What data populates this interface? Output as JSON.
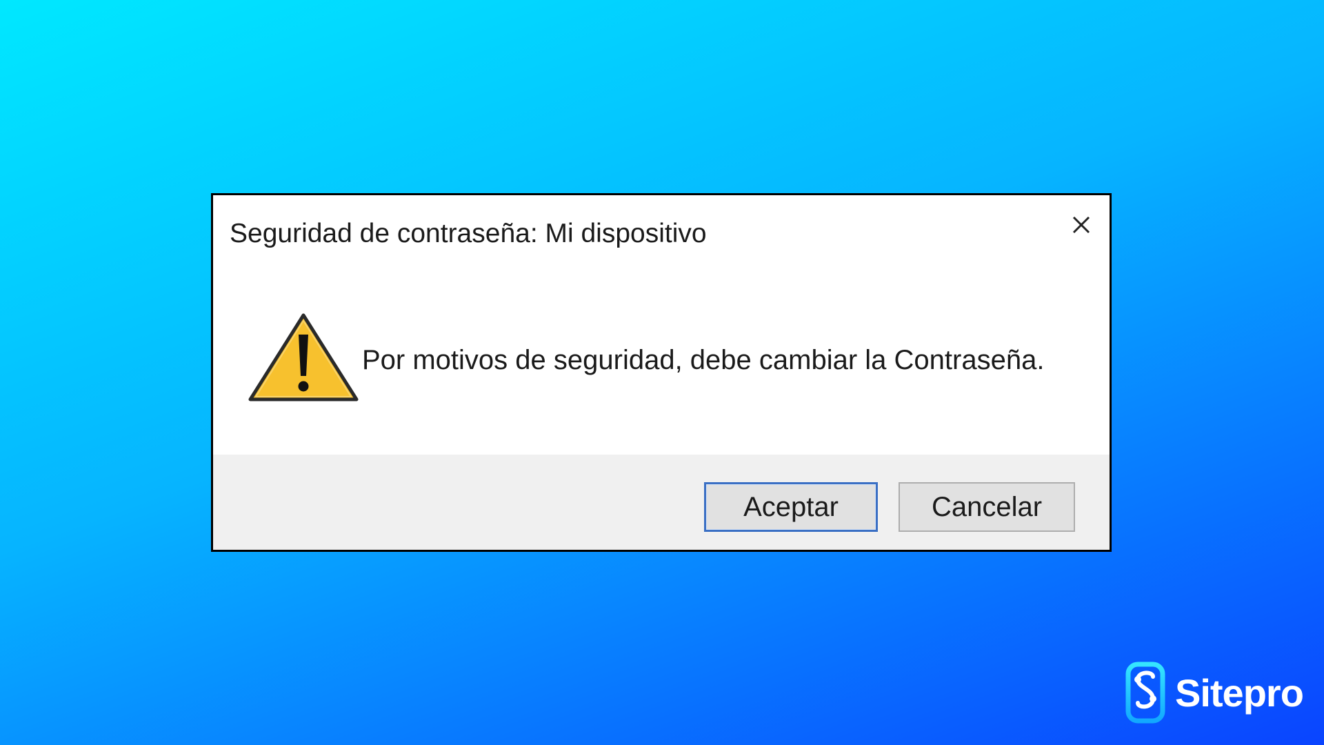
{
  "dialog": {
    "title": "Seguridad de contraseña: Mi dispositivo",
    "message": "Por motivos de seguridad, debe cambiar la Contraseña.",
    "icon": "warning-icon",
    "close_icon": "close-icon",
    "buttons": {
      "accept_label": "Aceptar",
      "cancel_label": "Cancelar"
    }
  },
  "brand": {
    "name": "Sitepro",
    "logo_icon": "sitepro-logo-icon"
  },
  "colors": {
    "background_top": "#00e8ff",
    "background_bottom": "#0a44ff",
    "dialog_border": "#000000",
    "footer_bg": "#f0f0f0",
    "default_button_border": "#3a6fc4",
    "warning_yellow": "#f7c12e"
  }
}
